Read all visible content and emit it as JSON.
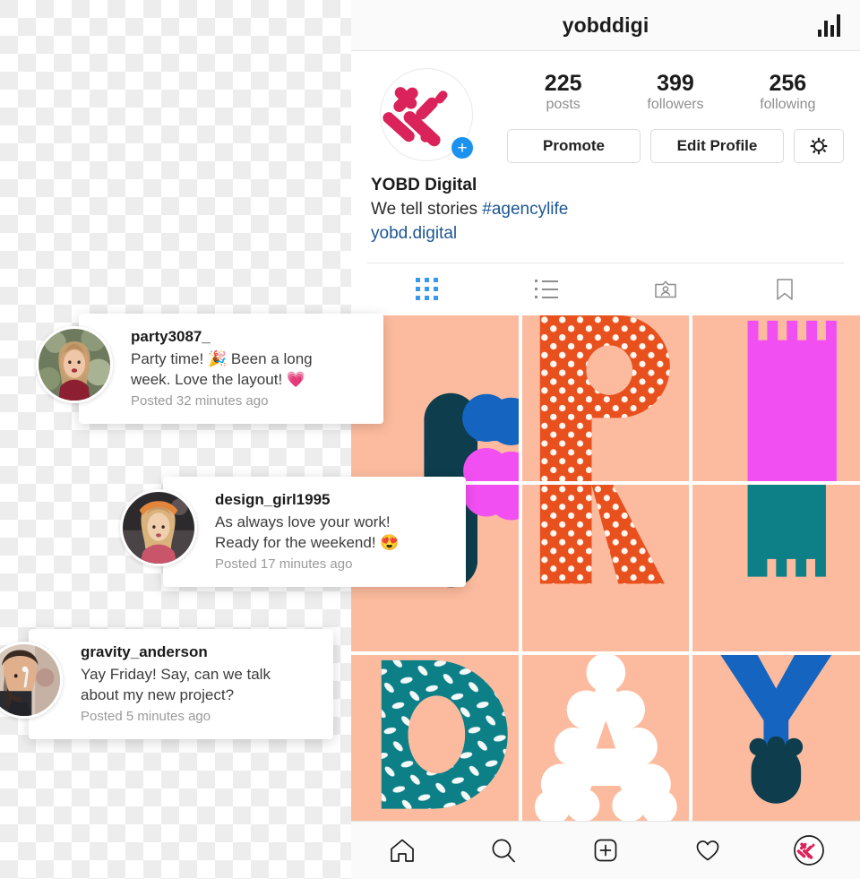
{
  "header": {
    "title": "yobddigi",
    "insights_icon": "bar-chart-icon"
  },
  "profile": {
    "avatar_icon": "yobd-logo-avatar",
    "add_story_label": "+",
    "stats": [
      {
        "value": "225",
        "label": "posts"
      },
      {
        "value": "399",
        "label": "followers"
      },
      {
        "value": "256",
        "label": "following"
      }
    ],
    "buttons": [
      {
        "label": "Promote",
        "name": "promote-button"
      },
      {
        "label": "Edit Profile",
        "name": "edit-profile-button"
      },
      {
        "label": "",
        "name": "settings-button",
        "icon": "gear-icon"
      }
    ],
    "bio": {
      "name": "YOBD Digital",
      "description": "We tell stories ",
      "hashtag": "#agencylife",
      "link": "yobd.digital"
    }
  },
  "tabs": [
    {
      "name": "tab-grid",
      "icon": "grid-icon",
      "active": true
    },
    {
      "name": "tab-list",
      "icon": "list-icon",
      "active": false
    },
    {
      "name": "tab-tagged",
      "icon": "tagged-person-icon",
      "active": false
    },
    {
      "name": "tab-saved",
      "icon": "bookmark-icon",
      "active": false
    }
  ],
  "grid": {
    "background_color": "#fcbb9e",
    "word": "FRIDAY",
    "cells": [
      {
        "name": "post-tile-f",
        "letter": "F"
      },
      {
        "name": "post-tile-r-top",
        "letter": "R"
      },
      {
        "name": "post-tile-i-top",
        "letter": "I"
      },
      {
        "name": "post-tile-f-bottom",
        "letter": "F"
      },
      {
        "name": "post-tile-r-bottom",
        "letter": "R"
      },
      {
        "name": "post-tile-i-bottom",
        "letter": "I"
      },
      {
        "name": "post-tile-d",
        "letter": "D"
      },
      {
        "name": "post-tile-a",
        "letter": "A"
      },
      {
        "name": "post-tile-y",
        "letter": "Y"
      }
    ],
    "colors": {
      "peach": "#fcbb9e",
      "dark_teal": "#0e3d4d",
      "blue": "#1565c0",
      "magenta": "#f24ff2",
      "orange": "#e8501e",
      "teal": "#0d7f86",
      "white": "#ffffff"
    }
  },
  "comments": [
    {
      "username": "party3087_",
      "message_line1": "Party time! 🎉 Been a long",
      "message_line2": "week. Love the layout! 💗",
      "timestamp": "Posted 32 minutes ago",
      "avatar": "party3087-avatar"
    },
    {
      "username": "design_girl1995",
      "message_line1": "As always love your work!",
      "message_line2": "Ready for the weekend! 😍",
      "timestamp": "Posted 17 minutes ago",
      "avatar": "design-girl1995-avatar"
    },
    {
      "username": "gravity_anderson",
      "message_line1": "Yay Friday! Say, can we talk",
      "message_line2": "about my new project?",
      "timestamp": "Posted 5 minutes ago",
      "avatar": "gravity-anderson-avatar"
    }
  ],
  "bottom_nav": [
    {
      "name": "nav-home",
      "icon": "home-icon"
    },
    {
      "name": "nav-search",
      "icon": "search-icon"
    },
    {
      "name": "nav-add",
      "icon": "plus-square-icon"
    },
    {
      "name": "nav-activity",
      "icon": "heart-icon"
    },
    {
      "name": "nav-profile",
      "icon": "profile-avatar-icon"
    }
  ]
}
